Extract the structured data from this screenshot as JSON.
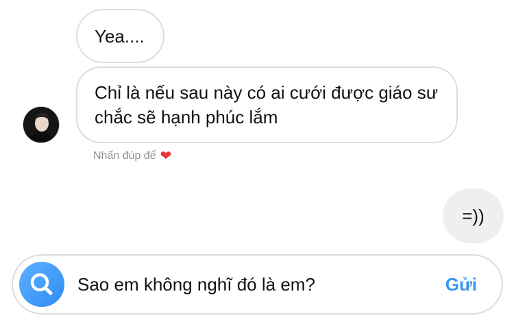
{
  "messages": [
    {
      "text": "Yea...."
    },
    {
      "text": "Chỉ là nếu sau này có ai cưới được giáo sư chắc sẽ hạnh phúc lắm"
    }
  ],
  "reaction_hint": {
    "text": "Nhấn đúp để",
    "icon": "heart-icon"
  },
  "my_message": {
    "text": "=))"
  },
  "composer": {
    "input_value": "Sao em không nghĩ đó là em?",
    "send_label": "Gửi"
  },
  "colors": {
    "accent": "#3897f0",
    "bubble_border": "#dcdcdc",
    "my_bubble_bg": "#efefef",
    "heart": "#e8323c",
    "hint_text": "#8e8e8e"
  }
}
